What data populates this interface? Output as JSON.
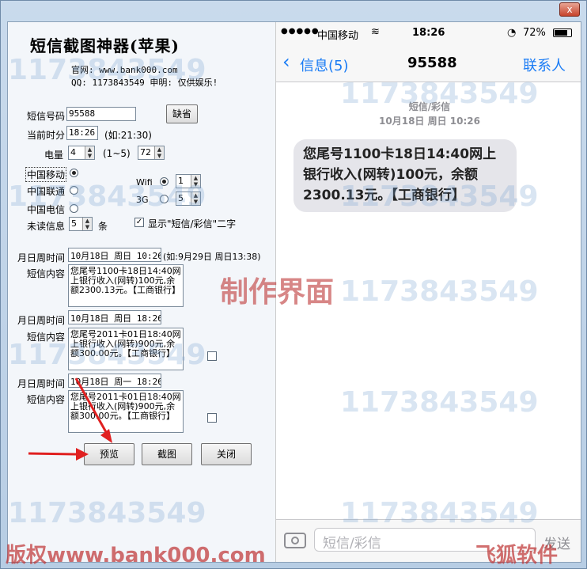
{
  "window": {
    "close_label": "x"
  },
  "app": {
    "title": "短信截图神器(苹果)",
    "website": "官网: www.bank000.com",
    "qq_line": "QQ: 1173843549  申明: 仅供娱乐!"
  },
  "form": {
    "sms_number_label": "短信号码",
    "sms_number_value": "95588",
    "default_button": "缺省",
    "time_label": "当前时分",
    "time_value": "18:26",
    "time_hint": "(如:21:30)",
    "battery_label": "电量",
    "battery_value": "4",
    "battery_range": "(1~5)",
    "battery_percent": "72",
    "carrier_mobile": "中国移动",
    "carrier_unicom": "中国联通",
    "carrier_telecom": "中国电信",
    "wifi_label": "Wifi",
    "wifi_value": "1",
    "net3g_label": "3G",
    "net3g_value": "5",
    "unread_label": "未读信息",
    "unread_value": "5",
    "unread_unit": "条",
    "show_sms_label": "显示\"短信/彩信\"二字",
    "show_sms_check": "✓",
    "msgs": [
      {
        "date_label": "月日周时间",
        "date_value": "10月18日  周日  10:26",
        "date_hint": "(如:9月29日 周日13:38)",
        "content_label": "短信内容",
        "content": "您尾号1100卡18日14:40网上银行收入(网转)100元,余额2300.13元。【工商银行】"
      },
      {
        "date_label": "月日周时间",
        "date_value": "10月18日  周日  18:26",
        "content_label": "短信内容",
        "content": "您尾号2011卡01日18:40网上银行收入(网转)900元,余额300.00元。【工商银行】"
      },
      {
        "date_label": "月日周时间",
        "date_value": "10月18日  周一  18:26",
        "content_label": "短信内容",
        "content": "您尾号2011卡01日18:40网上银行收入(网转)900元,余额300.00元。【工商银行】"
      }
    ],
    "preview_button": "预览",
    "screenshot_button": "截图",
    "close_button": "关闭"
  },
  "phone": {
    "signal": "●●●●●",
    "carrier": "中国移动",
    "wifi_glyph": "≋",
    "time": "18:26",
    "lock_glyph": "◔",
    "battery": "72%",
    "back_label": "信息(5)",
    "contact_number": "95588",
    "contacts_label": "联系人",
    "meta_type": "短信/彩信",
    "meta_date": "10月18日 周日 10:26",
    "bubble_text": "您尾号1100卡18日14:40网上银行收入(网转)100元，余额2300.13元。【工商银行】",
    "input_placeholder": "短信/彩信",
    "send_label": "发送"
  },
  "watermarks": {
    "number": "1173843549",
    "center_text": "制作界面",
    "bottom_left": "版权www.bank000.com",
    "bottom_right": "飞狐软件"
  }
}
